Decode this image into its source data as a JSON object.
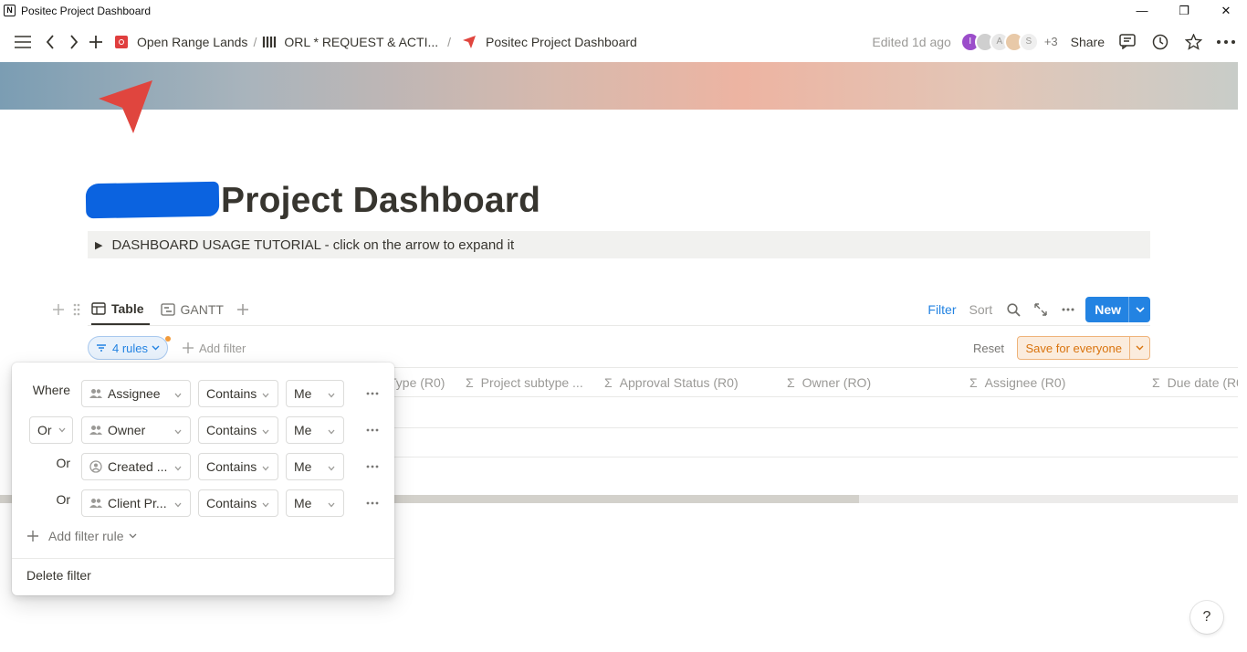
{
  "window": {
    "title": "Positec Project Dashboard",
    "app_icon_letter": "N",
    "minimize": "—",
    "maximize": "❐",
    "close": "✕"
  },
  "topbar": {
    "breadcrumbs": [
      {
        "label": "Open Range Lands",
        "icon": "red-square-icon"
      },
      {
        "label": "ORL * REQUEST & ACTI...",
        "icon": "database-icon"
      },
      {
        "label": "Positec Project Dashboard",
        "icon": "red-arrow-icon"
      }
    ],
    "separator": "/",
    "edited": "Edited 1d ago",
    "avatars": [
      "I",
      "",
      "A",
      "",
      "S"
    ],
    "avatar_colors": [
      "#9b4dca",
      "#cfcfcf",
      "#e3e3e3",
      "#e8c9a8",
      "#e3e3e3"
    ],
    "extra_count": "+3",
    "share": "Share"
  },
  "page": {
    "title": "Project Dashboard",
    "toggle_arrow": "▶",
    "toggle_text": "DASHBOARD USAGE TUTORIAL - click on the arrow to expand it"
  },
  "views": {
    "tabs": [
      {
        "label": "Table",
        "active": true
      },
      {
        "label": "GANTT",
        "active": false
      }
    ],
    "filter": "Filter",
    "sort": "Sort",
    "new": "New"
  },
  "filter_bar": {
    "rules_label": "4 rules",
    "add_filter": "Add filter",
    "reset": "Reset",
    "save_for_everyone": "Save for everyone"
  },
  "table": {
    "columns": [
      {
        "label": "Type (R0)",
        "icon": ""
      },
      {
        "label": "Project subtype ...",
        "icon": "Σ"
      },
      {
        "label": "Approval Status (R0)",
        "icon": "Σ"
      },
      {
        "label": "Owner (RO)",
        "icon": "Σ"
      },
      {
        "label": "Assignee (R0)",
        "icon": "Σ"
      },
      {
        "label": "Due date (R0",
        "icon": "Σ"
      }
    ]
  },
  "filter_popup": {
    "rules": [
      {
        "conjunction": "Where",
        "conj_select": false,
        "property": "Assignee",
        "property_icon": "people-icon",
        "operator": "Contains",
        "value": "Me"
      },
      {
        "conjunction": "Or",
        "conj_select": true,
        "property": "Owner",
        "property_icon": "people-icon",
        "operator": "Contains",
        "value": "Me"
      },
      {
        "conjunction": "Or",
        "conj_select": false,
        "property": "Created ...",
        "property_icon": "person-circle-icon",
        "operator": "Contains",
        "value": "Me"
      },
      {
        "conjunction": "Or",
        "conj_select": false,
        "property": "Client Pr...",
        "property_icon": "people-icon",
        "operator": "Contains",
        "value": "Me"
      }
    ],
    "add_rule": "Add filter rule",
    "delete_filter": "Delete filter"
  },
  "help": "?"
}
